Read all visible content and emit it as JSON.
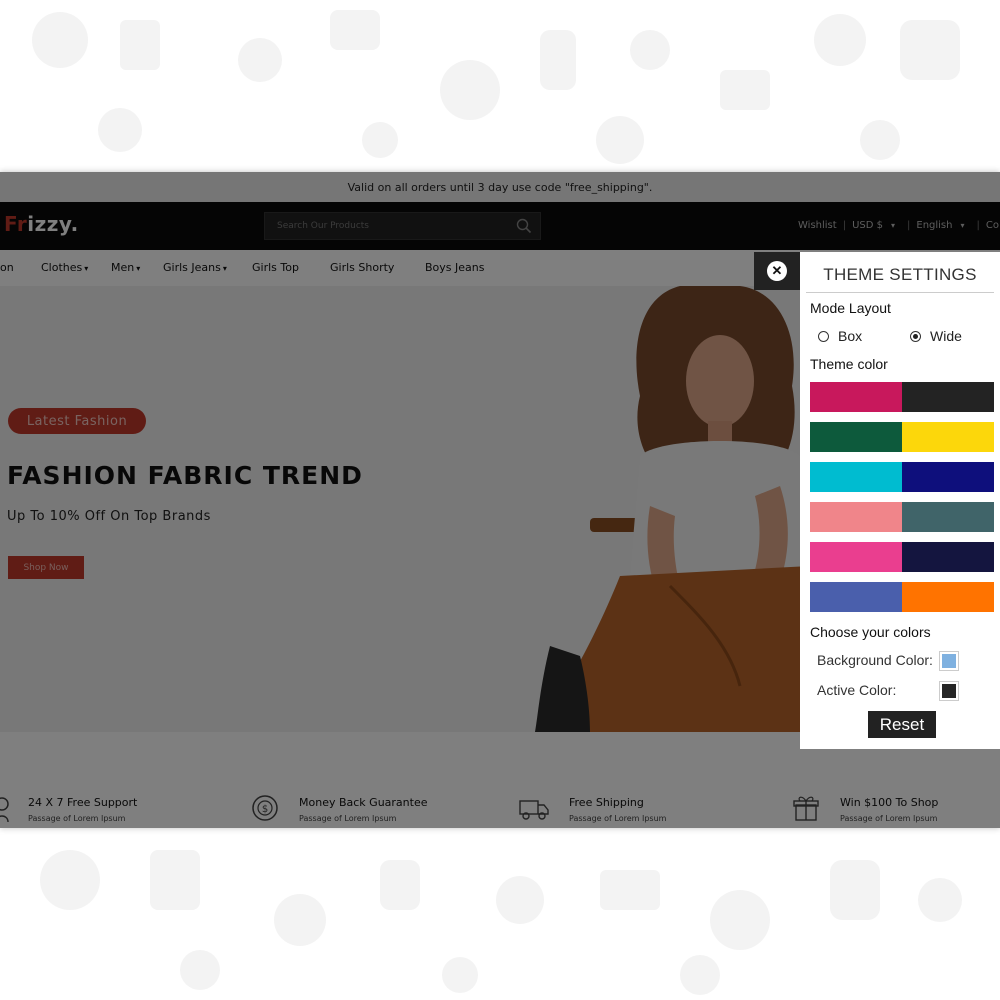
{
  "promo_bar": {
    "text": "Valid on all orders until 3 day use code \"free_shipping\"."
  },
  "header": {
    "logo_prefix": "Fr",
    "logo_rest": "izzy",
    "logo_dot": ".",
    "search_placeholder": "Search Our Products",
    "links": [
      "Wishlist",
      "|",
      "USD $",
      "|",
      "English",
      "|",
      "Co"
    ]
  },
  "nav": {
    "items": [
      {
        "label": "on",
        "has_dropdown": false
      },
      {
        "label": "Clothes",
        "has_dropdown": true
      },
      {
        "label": "Men",
        "has_dropdown": true
      },
      {
        "label": "Girls Jeans",
        "has_dropdown": true
      },
      {
        "label": "Girls Top",
        "has_dropdown": false
      },
      {
        "label": "Girls Shorty",
        "has_dropdown": false
      },
      {
        "label": "Boys Jeans",
        "has_dropdown": false
      }
    ]
  },
  "hero": {
    "badge": "Latest Fashion",
    "title": "FASHION FABRIC TREND",
    "subtitle": "Up To 10% Off On Top Brands",
    "button": "Shop Now"
  },
  "features": [
    {
      "title": "24 X 7 Free Support",
      "subtitle": "Passage of Lorem Ipsum",
      "icon": "support-icon"
    },
    {
      "title": "Money Back Guarantee",
      "subtitle": "Passage of Lorem Ipsum",
      "icon": "money-back-icon"
    },
    {
      "title": "Free Shipping",
      "subtitle": "Passage of Lorem Ipsum",
      "icon": "truck-icon"
    },
    {
      "title": "Win $100 To Shop",
      "subtitle": "Passage of Lorem Ipsum",
      "icon": "gift-icon"
    }
  ],
  "theme_panel": {
    "title": "THEME SETTINGS",
    "mode_layout_label": "Mode Layout",
    "mode_options": [
      {
        "label": "Box",
        "selected": false
      },
      {
        "label": "Wide",
        "selected": true
      }
    ],
    "theme_color_label": "Theme color",
    "swatches": [
      [
        "#c8185c",
        "#232323"
      ],
      [
        "#0d5a3c",
        "#fcd70b"
      ],
      [
        "#00bcd0",
        "#0e0f7c"
      ],
      [
        "#f0858a",
        "#406469"
      ],
      [
        "#ea3e8f",
        "#14153f"
      ],
      [
        "#4a5fac",
        "#ff7300"
      ]
    ],
    "choose_colors_label": "Choose your colors",
    "background_color_label": "Background Color:",
    "background_color_value": "#7fb1e0",
    "active_color_label": "Active Color:",
    "active_color_value": "#262626",
    "reset_label": "Reset"
  },
  "colors": {
    "accent": "#c0392b",
    "header_bg": "#0a0a0a",
    "overlay": "rgba(0,0,0,0.5)"
  }
}
